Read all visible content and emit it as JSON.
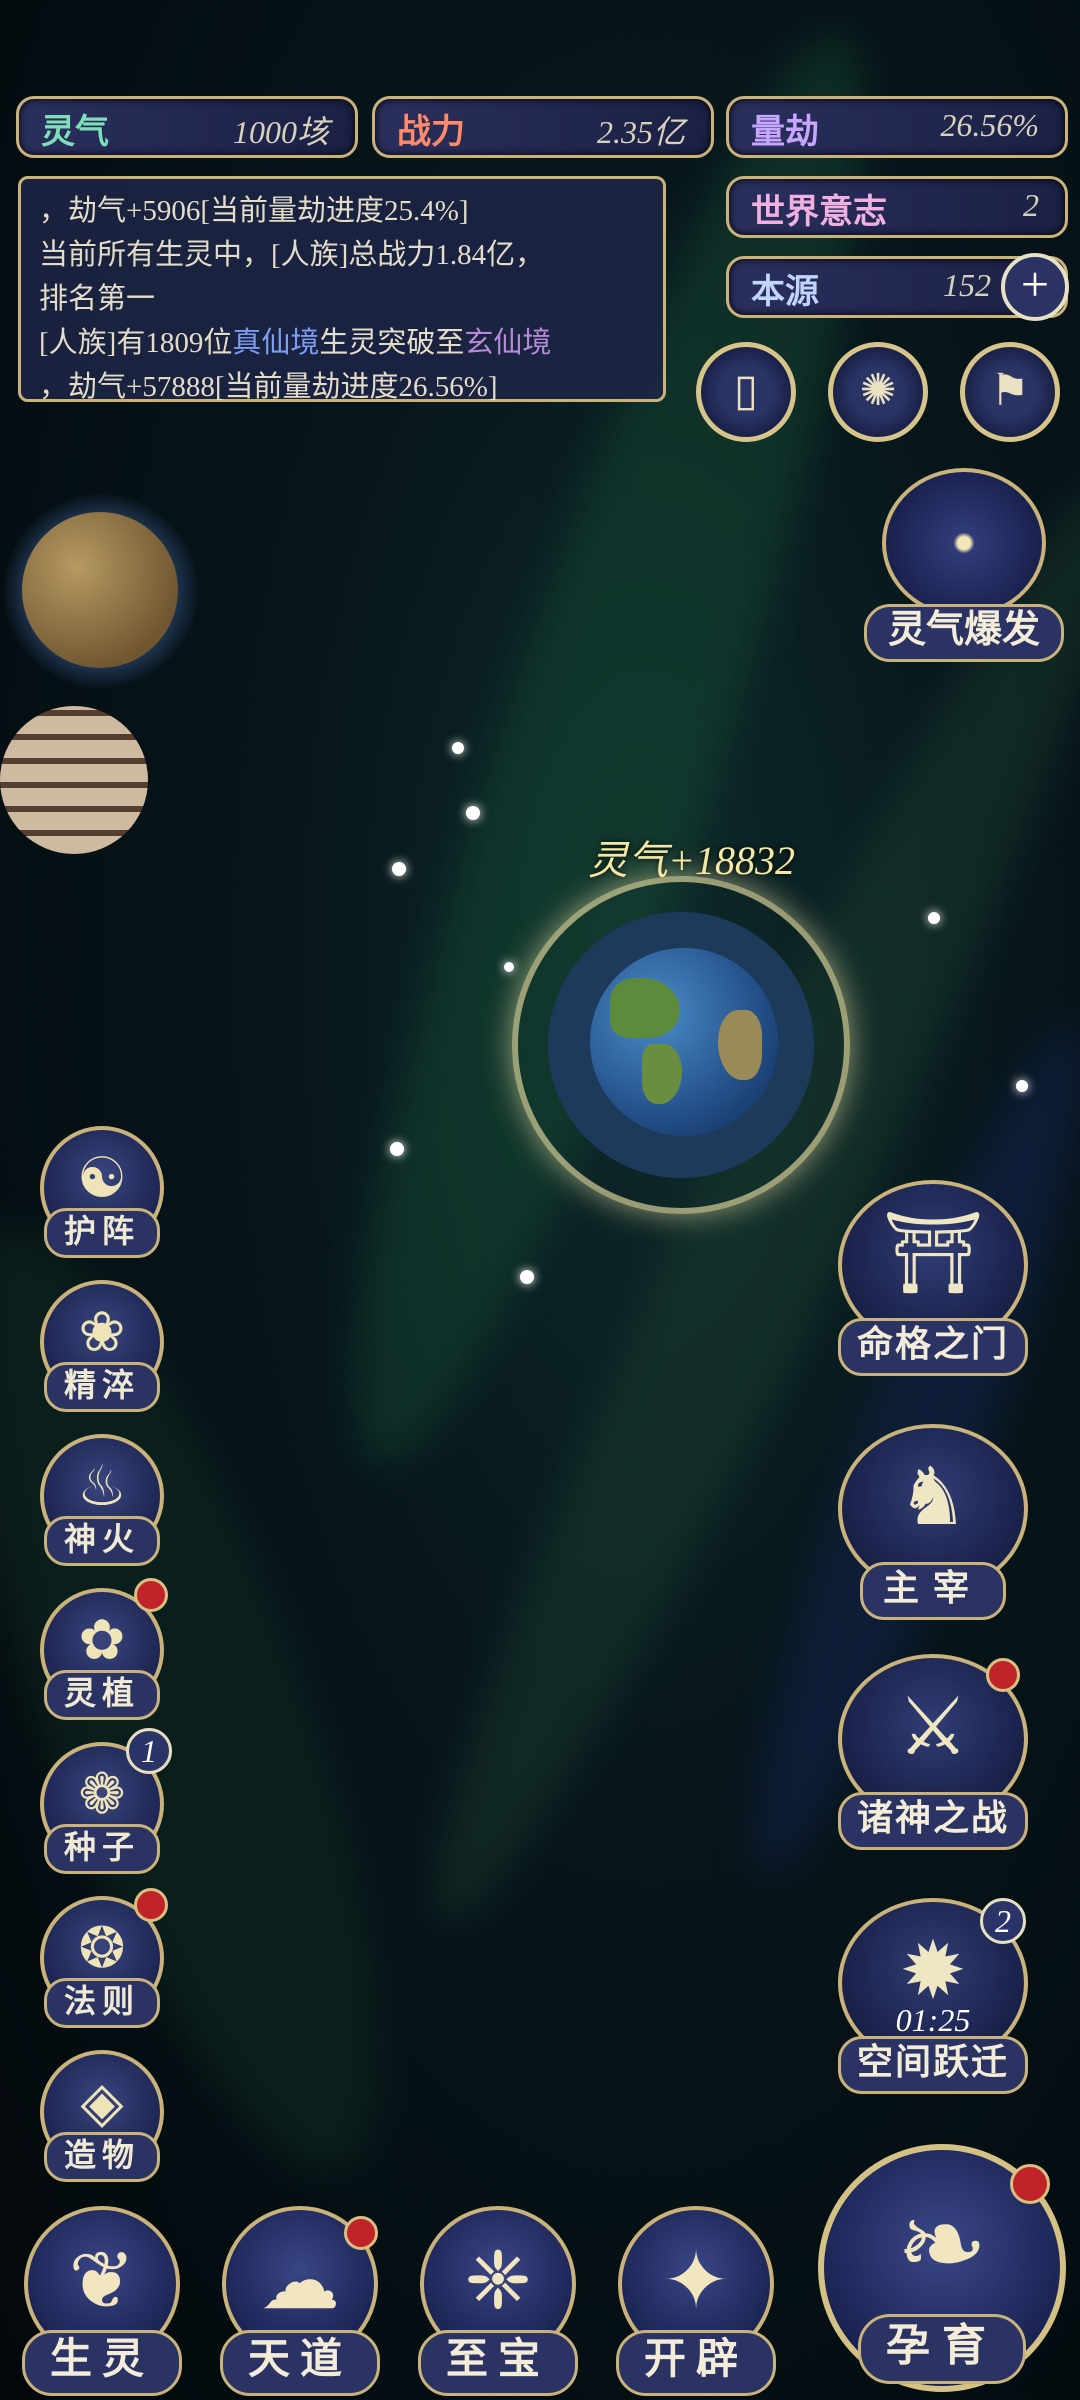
{
  "top_stats": {
    "lingqi": {
      "label": "灵气",
      "value": "1000垓",
      "color": "#7de0b8"
    },
    "zhanli": {
      "label": "战力",
      "value": "2.35亿",
      "color": "#ff8a6a"
    },
    "liangjie": {
      "label": "量劫",
      "value": "26.56%",
      "color": "#c8a6ff"
    },
    "shijie": {
      "label": "世界意志",
      "value": "2",
      "color": "#f0b0e0"
    },
    "benyuan": {
      "label": "本源",
      "value": "152",
      "color": "#c0d4ff",
      "plus": "+"
    }
  },
  "log": {
    "line1": "，劫气+5906[当前量劫进度25.4%]",
    "line2": "当前所有生灵中，[人族]总战力1.84亿，",
    "line3": "排名第一",
    "line4_a": "[人族]有1809位",
    "line4_b": "真仙境",
    "line4_c": "生灵突破至",
    "line4_d": "玄仙境",
    "line5": "，劫气+57888[当前量劫进度26.56%]"
  },
  "top_icons": [
    {
      "name": "card-icon",
      "glyph": "▯"
    },
    {
      "name": "vortex-icon",
      "glyph": "✺"
    },
    {
      "name": "flag-icon",
      "glyph": "⚑"
    }
  ],
  "lingqi_burst": {
    "label": "灵气爆发"
  },
  "planet_gain": "灵气+18832",
  "left_skills": [
    {
      "label": "护阵",
      "icon": "yin-yang-icon",
      "glyph": "☯",
      "dot": false
    },
    {
      "label": "精淬",
      "icon": "lotus-icon",
      "glyph": "❀",
      "dot": false
    },
    {
      "label": "神火",
      "icon": "flame-icon",
      "glyph": "♨",
      "dot": false
    },
    {
      "label": "灵植",
      "icon": "plant-icon",
      "glyph": "✿",
      "dot": true
    },
    {
      "label": "种子",
      "icon": "seed-icon",
      "glyph": "❁",
      "badge": "1"
    },
    {
      "label": "法则",
      "icon": "rune-icon",
      "glyph": "❂",
      "dot": true
    },
    {
      "label": "造物",
      "icon": "craft-icon",
      "glyph": "◈",
      "dot": false
    }
  ],
  "right_features": [
    {
      "label": "命格之门",
      "icon": "gate-icon",
      "glyph": "⛩"
    },
    {
      "label": "主宰",
      "icon": "dragon-icon",
      "glyph": "♞"
    },
    {
      "label": "诸神之战",
      "icon": "sword-icon",
      "glyph": "⚔",
      "dot": true
    },
    {
      "label": "空间跃迁",
      "icon": "portal-icon",
      "glyph": "✹",
      "badge": "2",
      "timer": "01:25"
    }
  ],
  "bottom_nav": [
    {
      "label": "生灵",
      "icon": "life-icon",
      "glyph": "❦",
      "dot": false
    },
    {
      "label": "天道",
      "icon": "heaven-icon",
      "glyph": "☁",
      "dot": true
    },
    {
      "label": "至宝",
      "icon": "treasure-icon",
      "glyph": "❈",
      "dot": false
    },
    {
      "label": "开辟",
      "icon": "creation-icon",
      "glyph": "✦",
      "dot": false
    }
  ],
  "big_nav": {
    "label": "孕育",
    "icon": "nurture-icon",
    "glyph": "❧",
    "dot": true
  }
}
